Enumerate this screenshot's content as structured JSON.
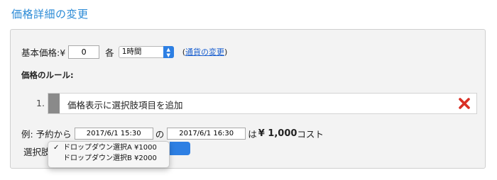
{
  "page": {
    "title": "価格詳細の変更"
  },
  "pricing": {
    "base_label": "基本価格:¥",
    "base_value": "0",
    "unit_label": "各",
    "unit_select": "1時間",
    "currency_open": "(",
    "currency_link": "通貨の変更",
    "currency_close": ")"
  },
  "rules": {
    "heading": "価格のルール:",
    "items": [
      {
        "index": "1.",
        "text": "価格表示に選択肢項目を追加"
      }
    ]
  },
  "example": {
    "prefix": "例: 予約から",
    "from_value": "2017/6/1 15:30",
    "joiner": "の",
    "to_value": "2017/6/1 16:30",
    "cost_prefix": "は",
    "cost_amount": "¥ 1,000",
    "cost_suffix": "コスト"
  },
  "choice": {
    "label": "選択肢",
    "options": [
      {
        "label": "ドロップダウン選択A ¥1000",
        "checked": true
      },
      {
        "label": "ドロップダウン選択B ¥2000",
        "checked": false
      }
    ]
  },
  "colors": {
    "title_blue": "#2a8ad6",
    "select_blue": "#2d7fe3",
    "delete_red": "#d93025"
  },
  "icons": {
    "check": "check-icon",
    "delete": "delete-x-icon",
    "select_arrows": "updown-chevron-icon",
    "drag": "drag-handle"
  }
}
